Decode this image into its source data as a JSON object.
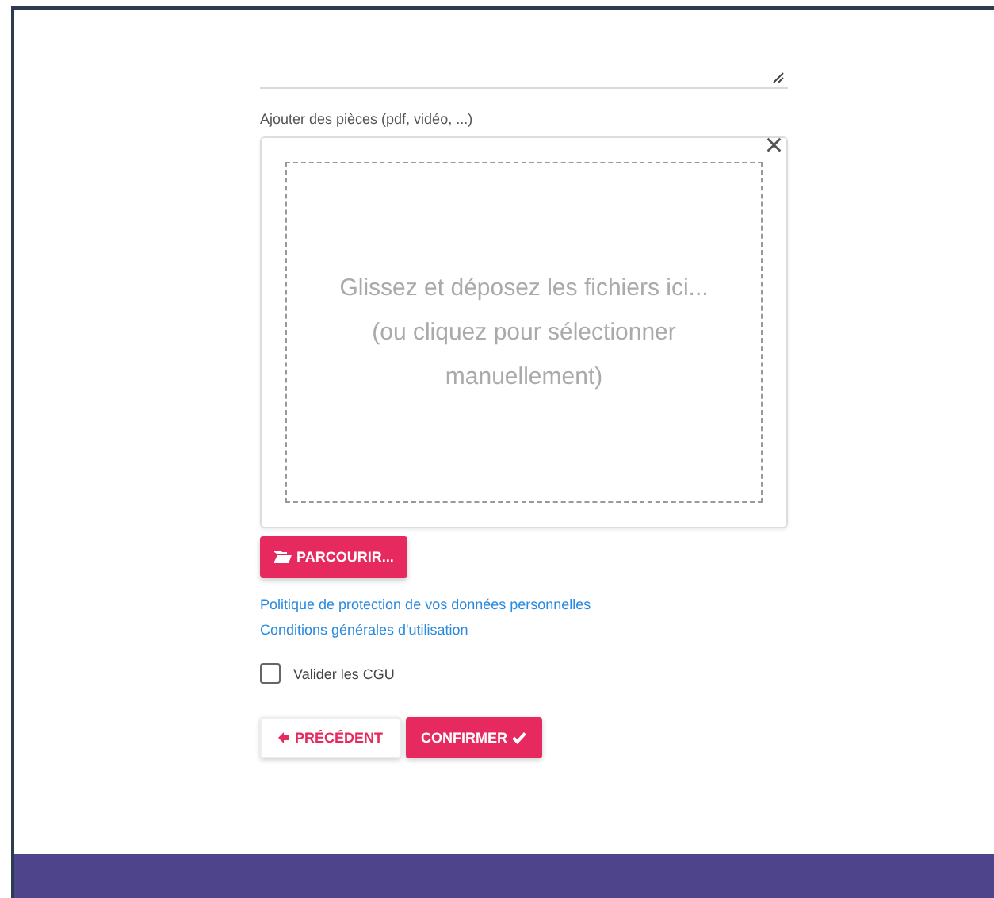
{
  "upload": {
    "label": "Ajouter des pièces (pdf, vidéo, ...)",
    "close": "×",
    "hint_lines": [
      "Glissez et déposez les fichiers ici...",
      "(ou cliquez pour sélectionner",
      "manuellement)"
    ],
    "browse_button": "PARCOURIR..."
  },
  "links": [
    "Politique de protection de vos données personnelles",
    "Conditions générales d'utilisation"
  ],
  "terms_checkbox": {
    "label": "Valider les CGU",
    "checked": false
  },
  "buttons": [
    {
      "kind": "secondary",
      "label": "PRÉCÉDENT"
    },
    {
      "kind": "primary",
      "label": "CONFIRMER"
    }
  ]
}
